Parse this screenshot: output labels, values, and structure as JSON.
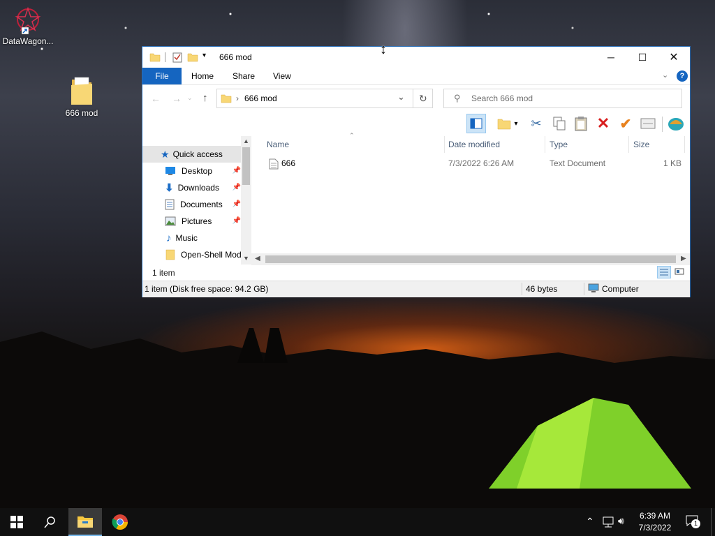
{
  "desktop": {
    "icons": [
      {
        "label": "DataWagon...",
        "icon": "app-shortcut-icon"
      },
      {
        "label": "666 mod",
        "icon": "folder-icon"
      }
    ]
  },
  "window": {
    "title": "666 mod",
    "ribbon_tabs": [
      "File",
      "Home",
      "Share",
      "View"
    ],
    "address": "666 mod",
    "search_placeholder": "Search 666 mod",
    "nav_items": [
      {
        "label": "Quick access",
        "pinned": false,
        "selected": true
      },
      {
        "label": "Desktop",
        "pinned": true
      },
      {
        "label": "Downloads",
        "pinned": true
      },
      {
        "label": "Documents",
        "pinned": true
      },
      {
        "label": "Pictures",
        "pinned": true
      },
      {
        "label": "Music",
        "pinned": false
      },
      {
        "label": "Open-Shell Mod",
        "pinned": false
      }
    ],
    "columns": [
      "Name",
      "Date modified",
      "Type",
      "Size"
    ],
    "files": [
      {
        "name": "666",
        "date": "7/3/2022 6:26 AM",
        "type": "Text Document",
        "size": "1 KB"
      }
    ],
    "item_count": "1 item",
    "status": {
      "left": "1 item (Disk free space: 94.2 GB)",
      "size": "46 bytes",
      "location": "Computer"
    }
  },
  "taskbar": {
    "time": "6:39 AM",
    "date": "7/3/2022",
    "notifications": "1"
  },
  "colors": {
    "accent": "#1565c0",
    "taskbar": "#101010",
    "folder": "#f8d775"
  }
}
